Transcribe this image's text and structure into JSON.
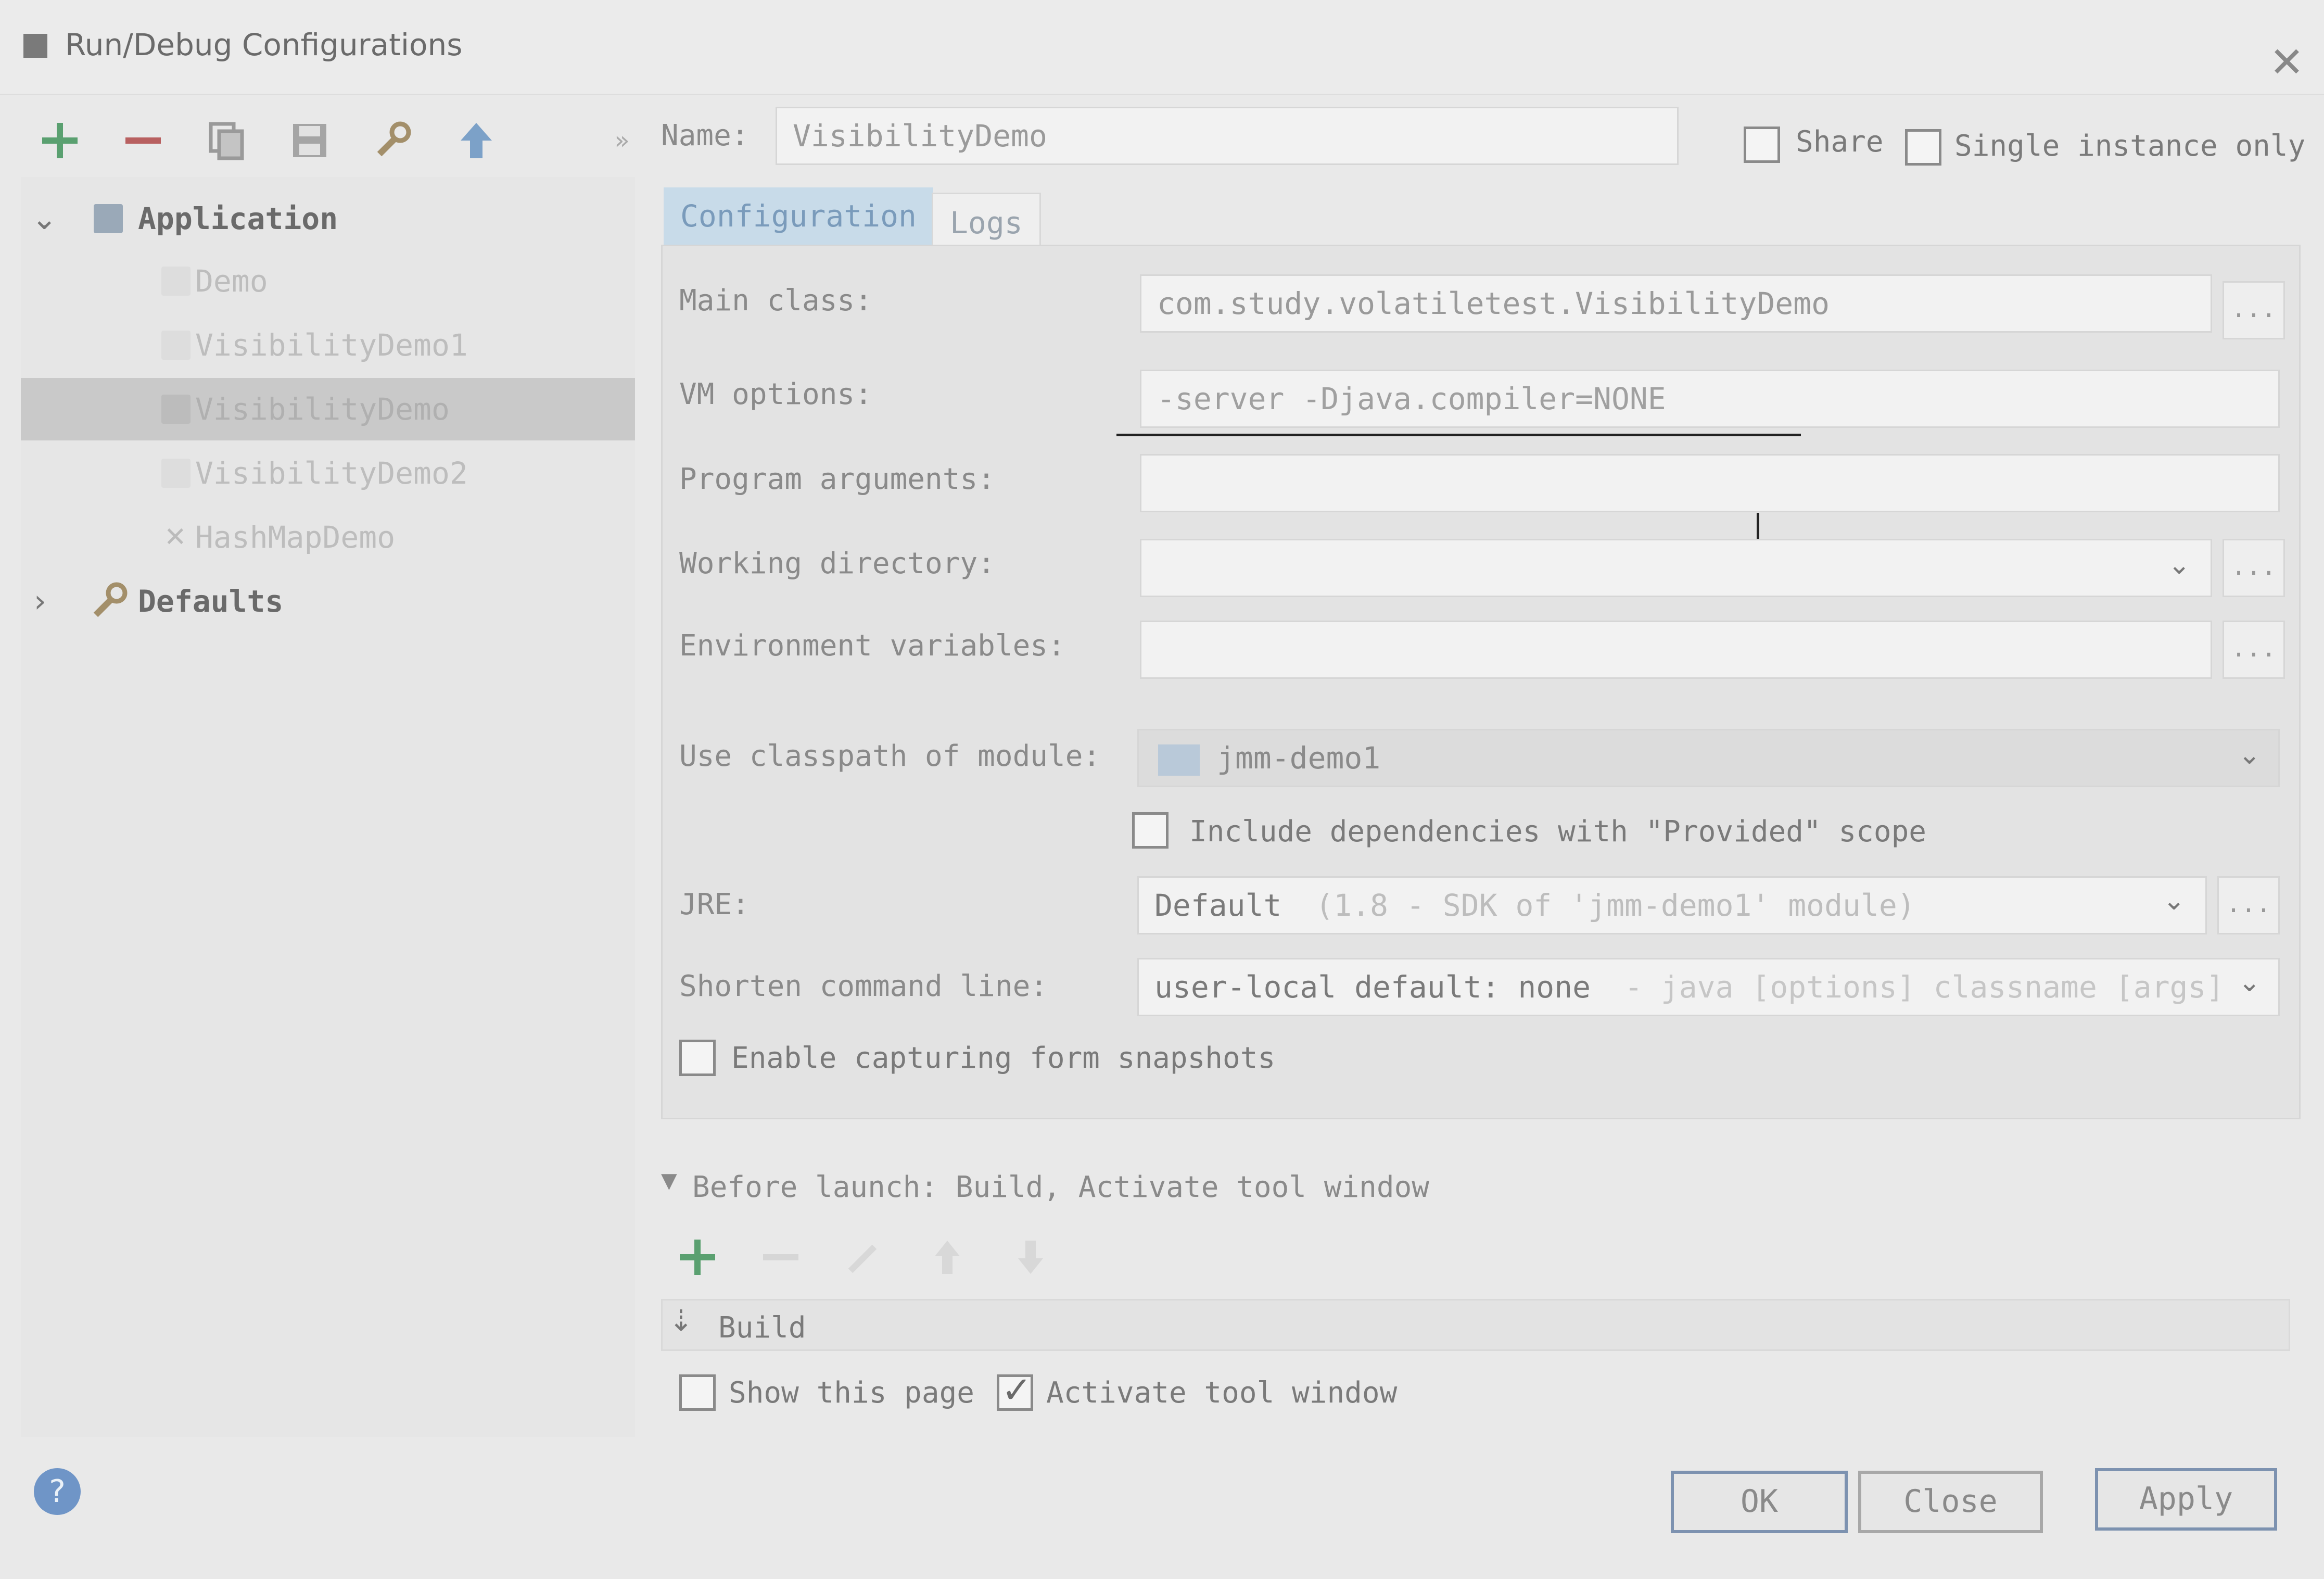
{
  "window": {
    "title": "Run/Debug Configurations"
  },
  "toolbar": {
    "icons": [
      "plus-icon",
      "minus-icon",
      "copy-icon",
      "save-icon",
      "wrench-icon",
      "arrow-up-icon"
    ],
    "overflow": "»"
  },
  "tree": {
    "application_label": "Application",
    "items": [
      {
        "label": "Demo"
      },
      {
        "label": "VisibilityDemo1"
      },
      {
        "label": "VisibilityDemo",
        "selected": true
      },
      {
        "label": "VisibilityDemo2"
      },
      {
        "label": "HashMapDemo"
      }
    ],
    "defaults_label": "Defaults"
  },
  "header": {
    "name_label": "Name:",
    "name_value": "VisibilityDemo",
    "share_label": "Share",
    "single_instance_label": "Single instance only"
  },
  "tabs": [
    {
      "label": "Configuration",
      "active": true
    },
    {
      "label": "Logs",
      "active": false
    }
  ],
  "form": {
    "main_class_label": "Main class:",
    "main_class_value": "com.study.volatiletest.VisibilityDemo",
    "vm_options_label": "VM options:",
    "vm_options_value": "-server -Djava.compiler=NONE",
    "program_args_label": "Program arguments:",
    "program_args_value": "",
    "working_dir_label": "Working directory:",
    "working_dir_value": "",
    "env_vars_label": "Environment variables:",
    "env_vars_value": "",
    "classpath_label": "Use classpath of module:",
    "classpath_value": "jmm-demo1",
    "include_deps_label": "Include dependencies with \"Provided\" scope",
    "jre_label": "JRE:",
    "jre_value": "Default",
    "jre_hint": "(1.8 - SDK of 'jmm-demo1' module)",
    "shorten_label": "Shorten command line:",
    "shorten_value": "user-local default: none",
    "shorten_hint": "- java [options] classname [args]",
    "snapshots_label": "Enable capturing form snapshots",
    "browse_label": "..."
  },
  "before_launch": {
    "header": "Before launch: Build, Activate tool window",
    "build_label": "Build",
    "show_page_label": "Show this page",
    "activate_label": "Activate tool window"
  },
  "buttons": {
    "ok": "OK",
    "close": "Close",
    "apply": "Apply"
  },
  "colors": {
    "accent_tab": "#c8dbe9",
    "button_border": "#7d92b0",
    "plus_green": "#5aa070"
  }
}
